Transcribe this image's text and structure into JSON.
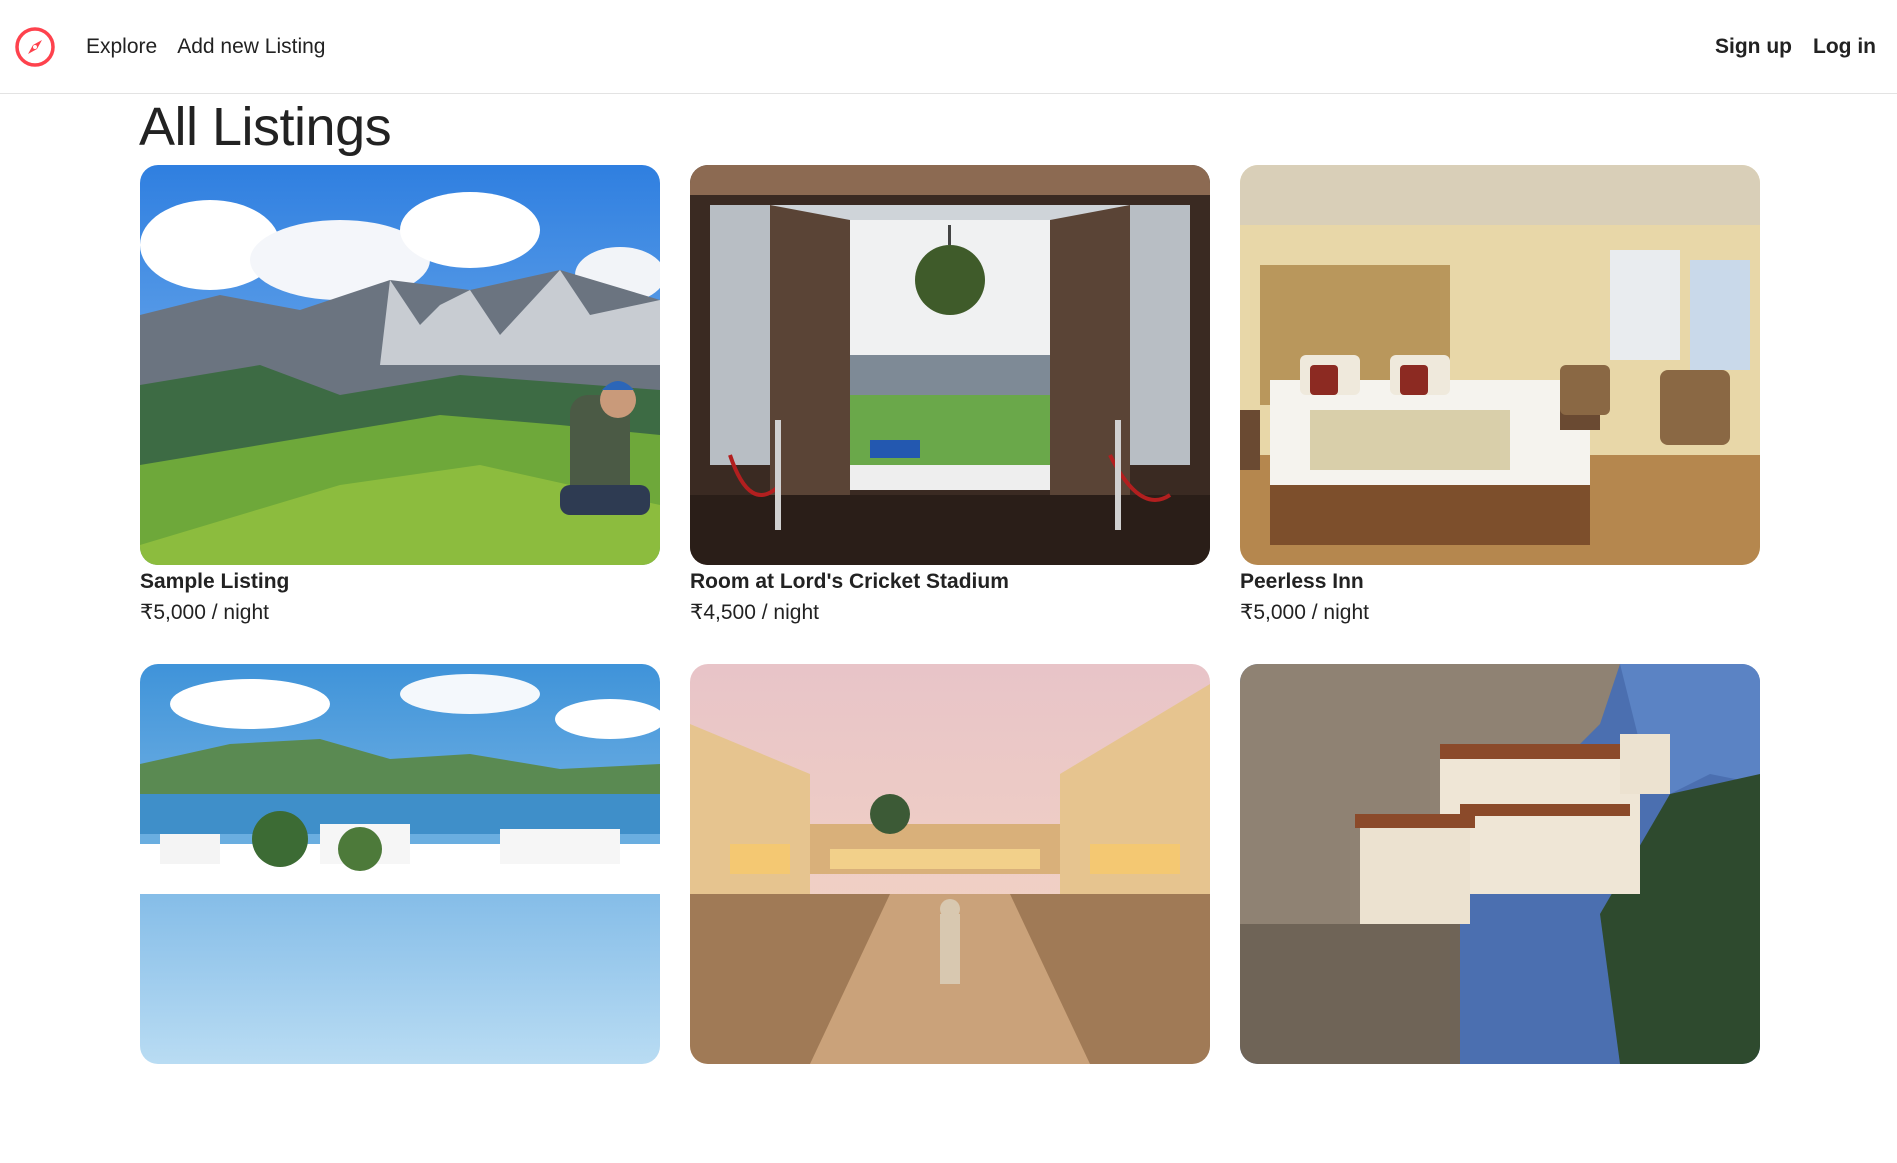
{
  "nav": {
    "logo_icon": "compass-icon",
    "brand_color": "#fe424d",
    "explore_label": "Explore",
    "add_listing_label": "Add new Listing",
    "signup_label": "Sign up",
    "login_label": "Log in"
  },
  "page": {
    "title": "All Listings"
  },
  "listings": [
    {
      "title": "Sample Listing",
      "price": "₹5,000",
      "per": " / night",
      "image": "mountain-meadow-photo"
    },
    {
      "title": "Room at Lord's Cricket Stadium",
      "price": "₹4,500",
      "per": " / night",
      "image": "cricket-stadium-view-photo"
    },
    {
      "title": "Peerless Inn",
      "price": "₹5,000",
      "per": " / night",
      "image": "hotel-bedroom-photo"
    },
    {
      "title": "",
      "price": "",
      "per": "",
      "image": "lake-palace-photo"
    },
    {
      "title": "",
      "price": "",
      "per": "",
      "image": "palace-courtyard-photo"
    },
    {
      "title": "",
      "price": "",
      "per": "",
      "image": "cliff-monastery-photo"
    }
  ]
}
